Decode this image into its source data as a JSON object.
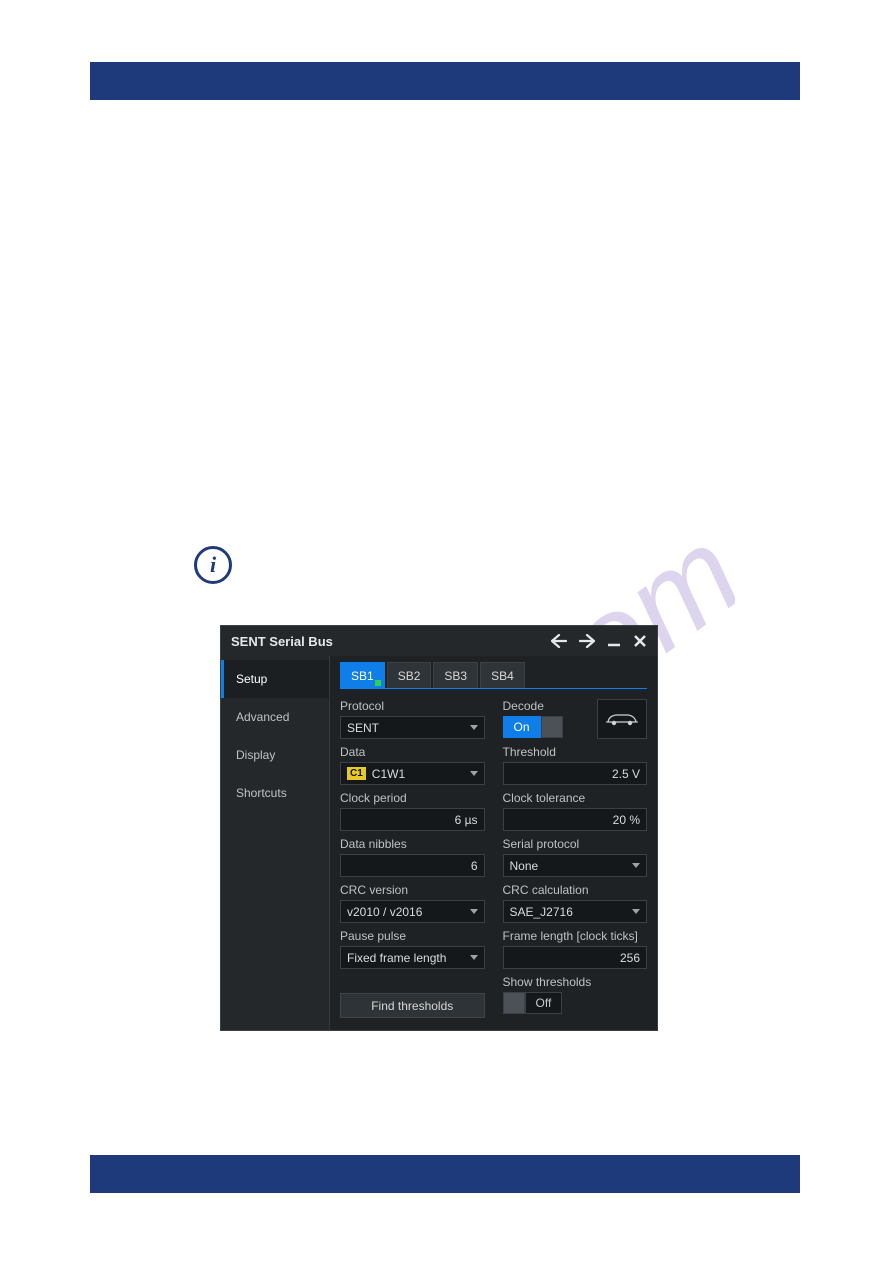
{
  "dialog": {
    "title": "SENT Serial Bus",
    "sidenav": {
      "items": [
        {
          "label": "Setup",
          "active": true
        },
        {
          "label": "Advanced",
          "active": false
        },
        {
          "label": "Display",
          "active": false
        },
        {
          "label": "Shortcuts",
          "active": false
        }
      ]
    },
    "tabs": [
      {
        "label": "SB1",
        "active": true
      },
      {
        "label": "SB2",
        "active": false
      },
      {
        "label": "SB3",
        "active": false
      },
      {
        "label": "SB4",
        "active": false
      }
    ],
    "fields": {
      "protocol": {
        "label": "Protocol",
        "value": "SENT"
      },
      "decode": {
        "label": "Decode",
        "value": "On"
      },
      "data": {
        "label": "Data",
        "chip": "C1",
        "value": "C1W1"
      },
      "threshold": {
        "label": "Threshold",
        "value": "2.5 V"
      },
      "clock_period": {
        "label": "Clock period",
        "value": "6 µs"
      },
      "clock_tolerance": {
        "label": "Clock tolerance",
        "value": "20 %"
      },
      "data_nibbles": {
        "label": "Data nibbles",
        "value": "6"
      },
      "serial_protocol": {
        "label": "Serial protocol",
        "value": "None"
      },
      "crc_version": {
        "label": "CRC version",
        "value": "v2010 / v2016"
      },
      "crc_calculation": {
        "label": "CRC calculation",
        "value": "SAE_J2716"
      },
      "pause_pulse": {
        "label": "Pause pulse",
        "value": "Fixed frame length"
      },
      "frame_length": {
        "label": "Frame length [clock ticks]",
        "value": "256"
      },
      "show_thresholds": {
        "label": "Show thresholds",
        "value": "Off"
      },
      "find_thresholds": {
        "label": "Find thresholds"
      }
    }
  },
  "info_icon_glyph": "i"
}
